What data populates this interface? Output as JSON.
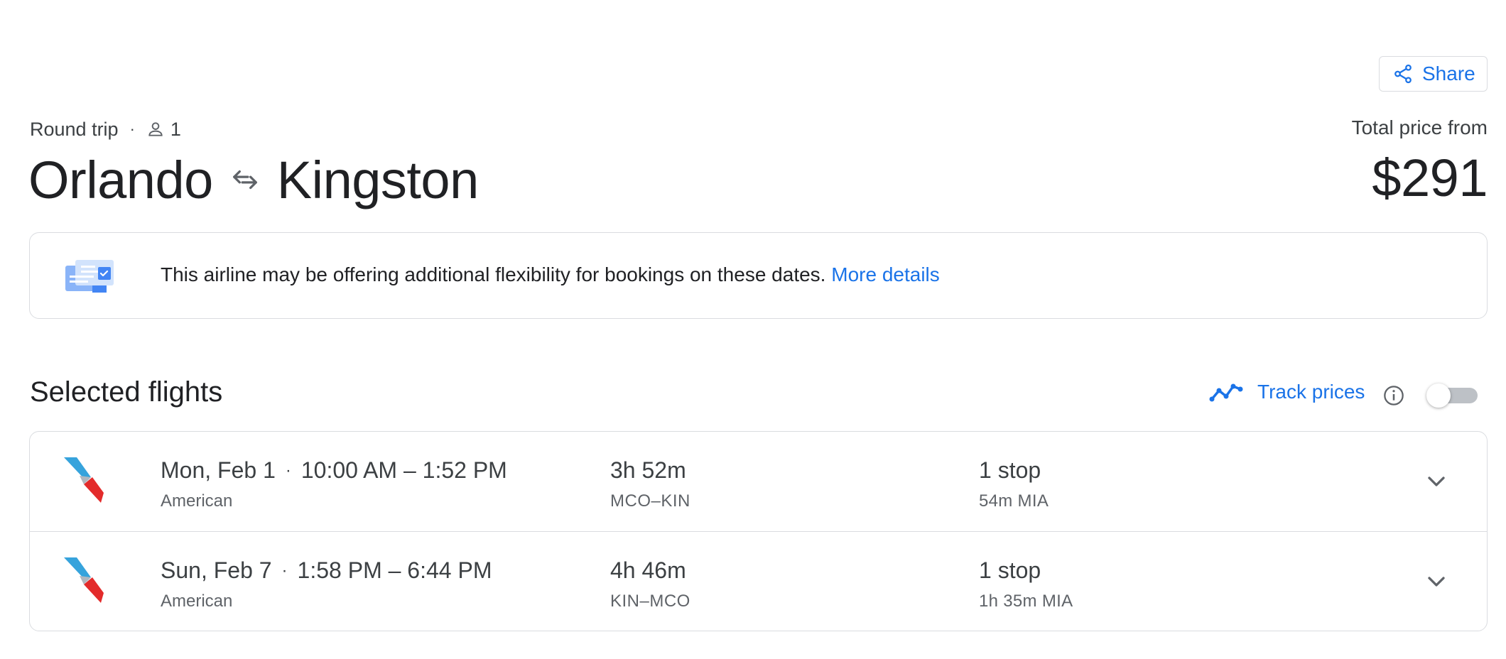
{
  "share": {
    "label": "Share",
    "icon": "share-icon"
  },
  "trip": {
    "type": "Round trip",
    "separator": "·",
    "passengers": "1",
    "origin": "Orlando",
    "destination": "Kingston"
  },
  "price": {
    "label": "Total price from",
    "value": "$291"
  },
  "banner": {
    "text": "This airline may be offering additional flexibility for bookings on these dates.",
    "link": "More details"
  },
  "selected": {
    "title": "Selected flights",
    "track_label": "Track prices",
    "track_enabled": false
  },
  "flights": [
    {
      "date": "Mon, Feb 1",
      "separator": "·",
      "times": "10:00 AM – 1:52 PM",
      "airline": "American",
      "duration": "3h 52m",
      "route": "MCO–KIN",
      "stops": "1 stop",
      "layover": "54m MIA"
    },
    {
      "date": "Sun, Feb 7",
      "separator": "·",
      "times": "1:58 PM – 6:44 PM",
      "airline": "American",
      "duration": "4h 46m",
      "route": "KIN–MCO",
      "stops": "1 stop",
      "layover": "1h 35m MIA"
    }
  ],
  "colors": {
    "accent": "#1a73e8",
    "border": "#dadce0",
    "text": "#202124",
    "muted": "#5f6368"
  }
}
